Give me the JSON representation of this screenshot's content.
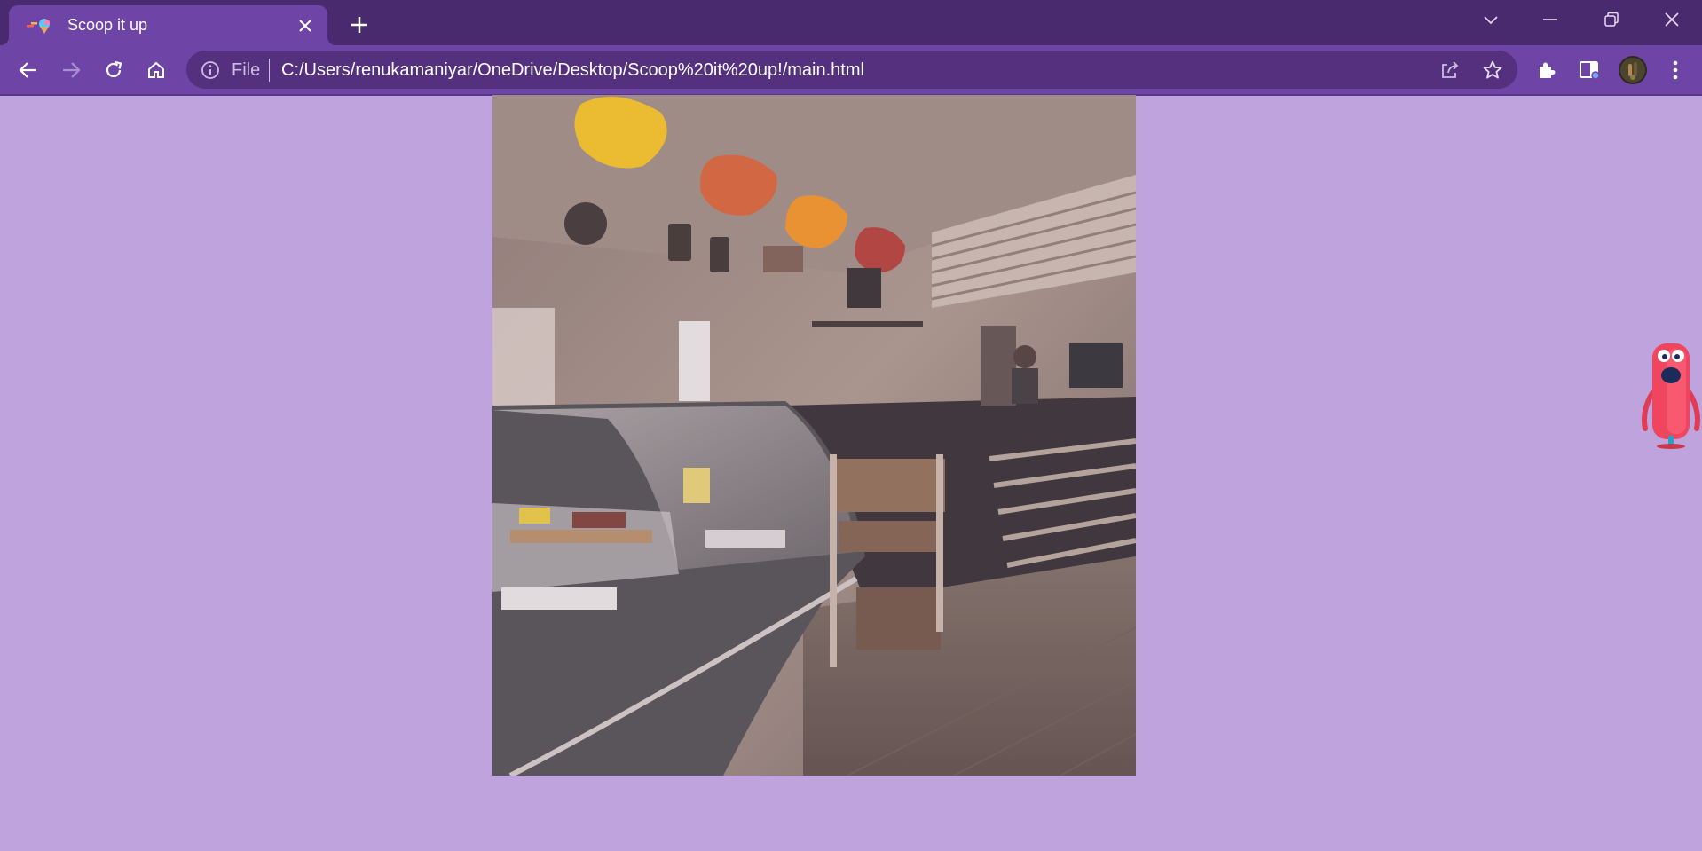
{
  "browser": {
    "tab": {
      "title": "Scoop it up"
    },
    "omnibox": {
      "scheme_label": "File",
      "url": "C:/Users/renukamaniyar/OneDrive/Desktop/Scoop%20it%20up!/main.html"
    },
    "icons": {
      "favicon": "ice-cream-favicon",
      "close_tab": "close-icon",
      "new_tab": "plus-icon",
      "tab_search": "chevron-down-icon",
      "minimize": "minimize-icon",
      "restore": "restore-icon",
      "close_window": "close-icon",
      "back": "arrow-left-icon",
      "forward": "arrow-right-icon",
      "reload": "reload-icon",
      "home": "home-icon",
      "site_info": "info-icon",
      "share": "share-icon",
      "bookmark": "star-icon",
      "extensions": "puzzle-icon",
      "side_panel": "side-panel-icon",
      "profile": "avatar",
      "menu": "kebab-menu-icon"
    }
  },
  "page": {
    "background_color": "#bea3dc",
    "hero_image": "ice-cream-shop-interior-photo",
    "mascot": "red-monster-mascot"
  },
  "colors": {
    "titlebar": "#4a2a6f",
    "active_tab": "#6e44a6",
    "omnibox": "#54307f"
  }
}
